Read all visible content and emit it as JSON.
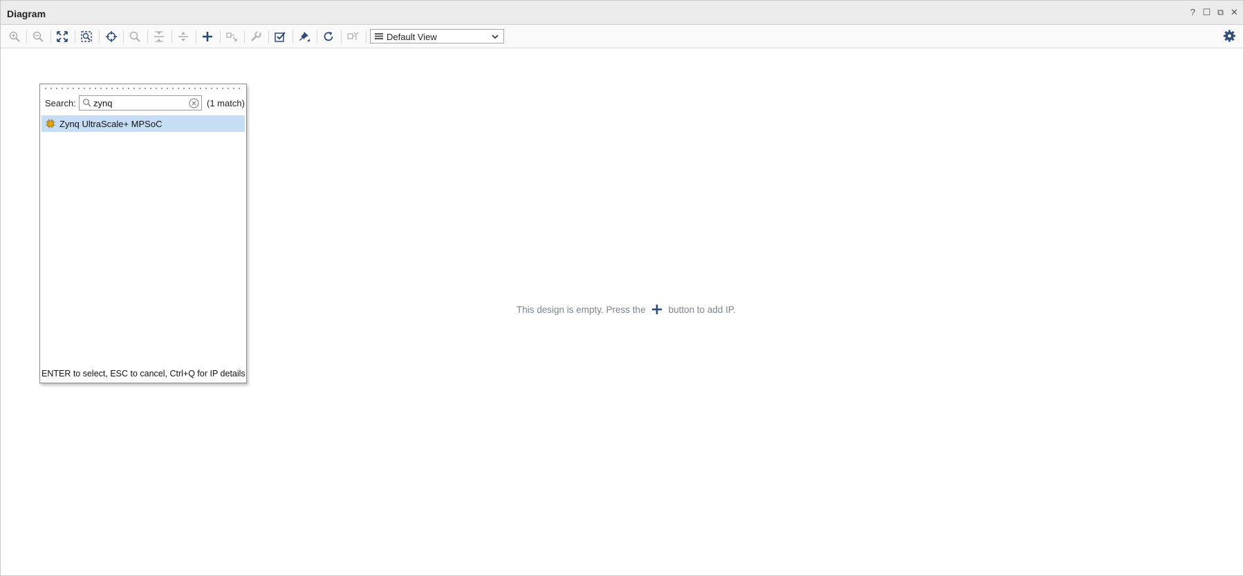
{
  "window": {
    "title": "Diagram",
    "controls": [
      "help-icon",
      "maximize-icon",
      "float-icon",
      "close-icon"
    ],
    "controls_glyphs": [
      "?",
      "☐",
      "⧉",
      "✕"
    ]
  },
  "toolbar": {
    "buttons": [
      {
        "name": "zoom-in-icon",
        "enabled": false
      },
      {
        "name": "zoom-out-icon",
        "enabled": false
      },
      {
        "name": "zoom-fit-icon",
        "enabled": true
      },
      {
        "name": "zoom-area-icon",
        "enabled": true
      },
      {
        "name": "auto-fit-selection-icon",
        "enabled": true
      },
      {
        "name": "search-icon",
        "enabled": false
      },
      {
        "name": "collapse-all-icon",
        "enabled": false
      },
      {
        "name": "expand-all-icon",
        "enabled": false
      },
      {
        "name": "add-ip-icon",
        "enabled": true
      },
      {
        "name": "make-connection-icon",
        "enabled": false
      },
      {
        "name": "properties-wrench-icon",
        "enabled": false
      },
      {
        "name": "validate-design-icon",
        "enabled": true
      },
      {
        "name": "run-automation-pin-icon",
        "enabled": true
      },
      {
        "name": "refresh-icon",
        "enabled": true
      },
      {
        "name": "optimize-routing-icon",
        "enabled": false
      }
    ],
    "view_select": {
      "selected": "Default View"
    },
    "settings": "gear-icon"
  },
  "canvas": {
    "empty_text_before": "This design is empty. Press the",
    "empty_text_after": "button to add IP.",
    "accent": "#2c4a78"
  },
  "search_popup": {
    "label": "Search:",
    "query": "zynq",
    "match_count": "(1 match)",
    "results": [
      {
        "label": "Zynq UltraScale+ MPSoC",
        "selected": true,
        "icon": "ip-core-icon"
      }
    ],
    "hint": "ENTER to select, ESC to cancel, Ctrl+Q for IP details",
    "selection_color": "#c7dcf5"
  }
}
